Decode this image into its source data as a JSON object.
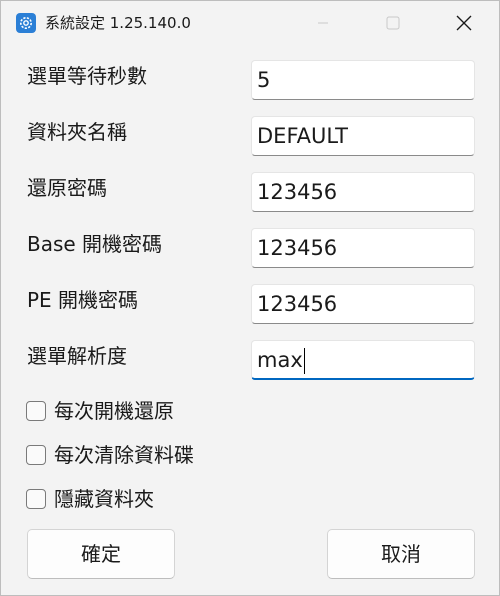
{
  "window": {
    "title": "系統設定 1.25.140.0",
    "app_icon": "gear-icon",
    "accent_color": "#2b7fd6"
  },
  "form": {
    "rows": [
      {
        "label": "選單等待秒數",
        "value": "5"
      },
      {
        "label": "資料夾名稱",
        "value": "DEFAULT"
      },
      {
        "label": "還原密碼",
        "value": "123456"
      },
      {
        "label": "Base 開機密碼",
        "value": "123456"
      },
      {
        "label": "PE 開機密碼",
        "value": "123456"
      },
      {
        "label": "選單解析度",
        "value": "max"
      }
    ]
  },
  "options": [
    {
      "label": "每次開機還原",
      "checked": false
    },
    {
      "label": "每次清除資料碟",
      "checked": false
    },
    {
      "label": "隱藏資料夾",
      "checked": false
    }
  ],
  "buttons": {
    "ok_label": "確定",
    "cancel_label": "取消"
  }
}
